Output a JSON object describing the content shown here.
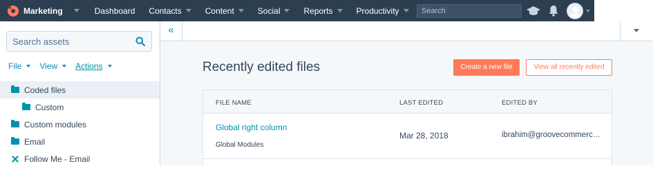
{
  "nav": {
    "brand": "Marketing",
    "items": [
      "Dashboard",
      "Contacts",
      "Content",
      "Social",
      "Reports",
      "Productivity"
    ],
    "search_placeholder": "Search"
  },
  "sidebar": {
    "search_placeholder": "Search assets",
    "menus": [
      "File",
      "View",
      "Actions"
    ],
    "tree": [
      {
        "label": "Coded files",
        "level": 0,
        "icon": "folder-open-icon",
        "active": true
      },
      {
        "label": "Custom",
        "level": 1,
        "icon": "folder-icon",
        "active": false
      },
      {
        "label": "Custom modules",
        "level": 0,
        "icon": "folder-icon",
        "active": false
      },
      {
        "label": "Email",
        "level": 0,
        "icon": "folder-icon",
        "active": false
      },
      {
        "label": "Follow Me - Email",
        "level": 0,
        "icon": "x-icon",
        "active": false
      }
    ]
  },
  "tabbar": {
    "collapse_label": "«"
  },
  "main": {
    "title": "Recently edited files",
    "create_button": "Create a new file",
    "view_all_button": "View all recently edited",
    "columns": [
      "FILE NAME",
      "LAST EDITED",
      "EDITED BY"
    ],
    "rows": [
      {
        "name": "Global right column",
        "type": "Global Modules",
        "last_edited": "Mar 28, 2018",
        "edited_by": "ibrahim@groovecommerce.com"
      }
    ]
  },
  "colors": {
    "accent": "#ff7a59",
    "link": "#0091ae",
    "nav_bg": "#2d3e50"
  }
}
